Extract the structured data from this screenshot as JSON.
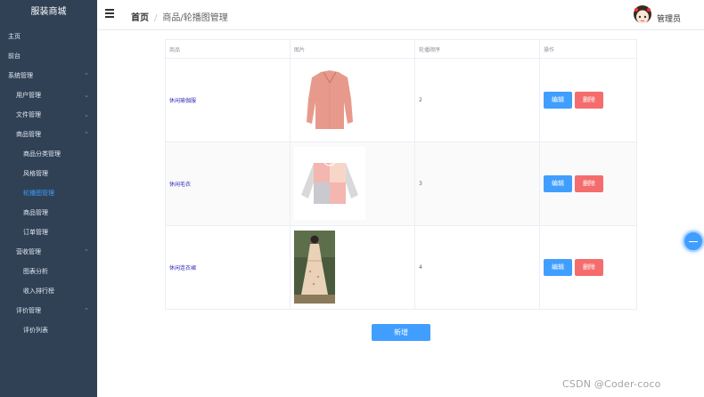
{
  "sidebar": {
    "title": "服装商城",
    "items": [
      {
        "label": "主页",
        "level": 1,
        "has_children": false
      },
      {
        "label": "前台",
        "level": 1,
        "has_children": false
      },
      {
        "label": "系统管理",
        "level": 1,
        "has_children": true,
        "expanded": true
      },
      {
        "label": "用户管理",
        "level": 2,
        "has_children": true,
        "expanded": false
      },
      {
        "label": "文件管理",
        "level": 2,
        "has_children": true,
        "expanded": false
      },
      {
        "label": "商品管理",
        "level": 2,
        "has_children": true,
        "expanded": true
      },
      {
        "label": "商品分类管理",
        "level": 3
      },
      {
        "label": "风格管理",
        "level": 3
      },
      {
        "label": "轮播图管理",
        "level": 3,
        "active": true
      },
      {
        "label": "商品管理",
        "level": 3
      },
      {
        "label": "订单管理",
        "level": 3
      },
      {
        "label": "营收管理",
        "level": 2,
        "has_children": true,
        "expanded": true
      },
      {
        "label": "图表分析",
        "level": 3
      },
      {
        "label": "收入排行榜",
        "level": 3
      },
      {
        "label": "评价管理",
        "level": 2,
        "has_children": true,
        "expanded": true
      },
      {
        "label": "评价列表",
        "level": 3
      }
    ]
  },
  "header": {
    "breadcrumb_home": "首页",
    "breadcrumb_sep": "/",
    "breadcrumb_current": "商品/轮播图管理",
    "username": "管理员"
  },
  "table": {
    "columns": [
      "商品",
      "图片",
      "轮播顺序",
      "操作"
    ],
    "rows": [
      {
        "name": "休闲瑜伽服",
        "sort": "2",
        "image": "pink-top"
      },
      {
        "name": "休闲毛衣",
        "sort": "3",
        "image": "sweater"
      },
      {
        "name": "休闲连衣裙",
        "sort": "4",
        "image": "dress"
      }
    ],
    "edit_label": "编辑",
    "delete_label": "删除"
  },
  "add_label": "新增",
  "watermark": "CSDN @Coder-coco",
  "colors": {
    "sidebar_bg": "#304156",
    "primary": "#409eff",
    "danger": "#f56c6c",
    "active_menu": "#409eff"
  }
}
